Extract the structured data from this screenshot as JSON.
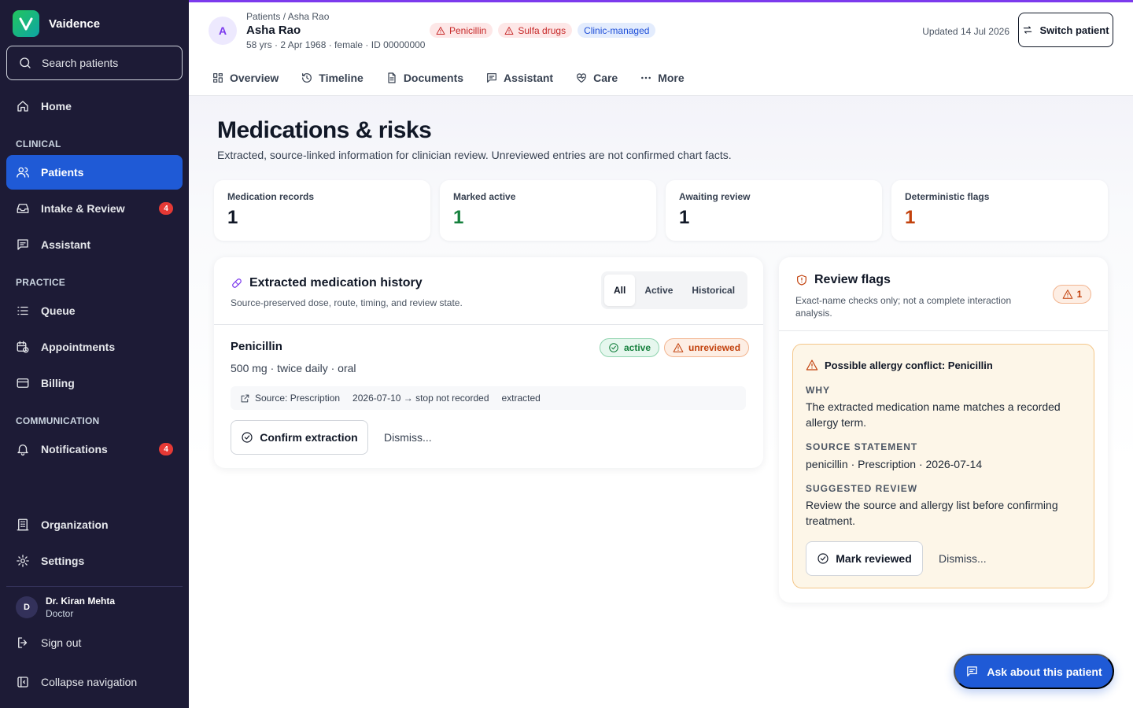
{
  "app": {
    "name": "Vaidence"
  },
  "sidebar": {
    "search_placeholder": "Search patients",
    "home": "Home",
    "sections": {
      "clinical": "CLINICAL",
      "practice": "PRACTICE",
      "communication": "COMMUNICATION"
    },
    "items": {
      "patients": "Patients",
      "intake": "Intake & Review",
      "intake_badge": "4",
      "assistant": "Assistant",
      "queue": "Queue",
      "appointments": "Appointments",
      "billing": "Billing",
      "notifications": "Notifications",
      "notifications_badge": "4",
      "organization": "Organization",
      "settings": "Settings"
    },
    "user": {
      "initial": "D",
      "name": "Dr. Kiran Mehta",
      "role": "Doctor"
    },
    "sign_out": "Sign out",
    "collapse": "Collapse navigation"
  },
  "header": {
    "avatar_initial": "A",
    "breadcrumb": "Patients / Asha Rao",
    "patient_name": "Asha Rao",
    "patient_meta": "58 yrs · 2 Apr 1968 · female · ID 00000000",
    "chips": {
      "allergy1": "Penicillin",
      "allergy2": "Sulfa drugs",
      "managed": "Clinic-managed"
    },
    "updated": "Updated 14 Jul 2026",
    "switch_label": "Switch patient"
  },
  "tabs": {
    "overview": "Overview",
    "timeline": "Timeline",
    "documents": "Documents",
    "assistant": "Assistant",
    "care": "Care",
    "more": "More"
  },
  "page": {
    "title": "Medications & risks",
    "subtitle": "Extracted, source-linked information for clinician review. Unreviewed entries are not confirmed chart facts."
  },
  "stats": [
    {
      "label": "Medication records",
      "value": "1"
    },
    {
      "label": "Marked active",
      "value": "1"
    },
    {
      "label": "Awaiting review",
      "value": "1"
    },
    {
      "label": "Deterministic flags",
      "value": "1"
    }
  ],
  "colors": {
    "accent": "#1f5ad6",
    "active": "#15803d",
    "flag": "#c2410c",
    "header_bar": "#7c3aed"
  },
  "medications": {
    "title": "Extracted medication history",
    "subtitle": "Source-preserved dose, route, timing, and review state.",
    "filters": {
      "all": "All",
      "active": "Active",
      "historical": "Historical",
      "selected": "All"
    },
    "item": {
      "name": "Penicillin",
      "detail": "500 mg · twice daily · oral",
      "status": "active",
      "review_state": "unreviewed",
      "source": "Source: Prescription",
      "dates": "2026-07-10 → stop not recorded",
      "method": "extracted",
      "confirm": "Confirm extraction",
      "dismiss": "Dismiss..."
    }
  },
  "flags": {
    "title": "Review flags",
    "subtitle": "Exact-name checks only; not a complete interaction analysis.",
    "count": "1",
    "flag": {
      "title": "Possible allergy conflict: Penicillin",
      "why_label": "WHY",
      "why": "The extracted medication name matches a recorded allergy term.",
      "source_label": "SOURCE STATEMENT",
      "source": "penicillin · Prescription · 2026-07-14",
      "suggest_label": "SUGGESTED REVIEW",
      "suggest": "Review the source and allergy list before confirming treatment.",
      "mark": "Mark reviewed",
      "dismiss": "Dismiss..."
    }
  },
  "fab": "Ask about this patient"
}
